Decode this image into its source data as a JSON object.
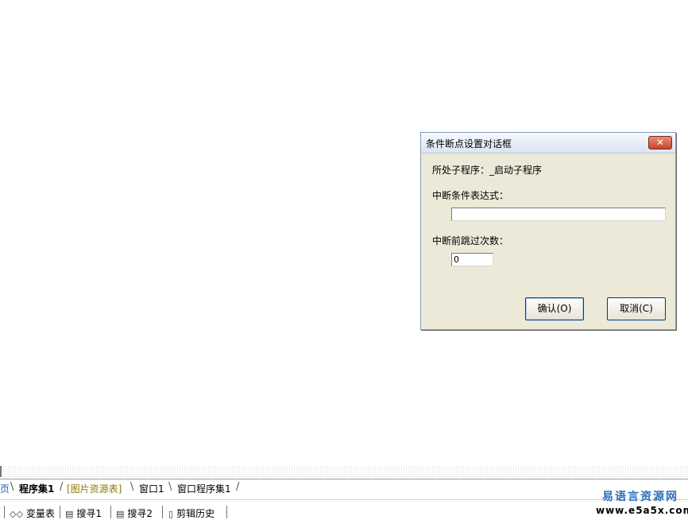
{
  "dialog": {
    "title": "条件断点设置对话框",
    "close_symbol": "✕",
    "subprogram_label": "所处子程序：",
    "subprogram_value": "_启动子程序",
    "condition_label": "中断条件表达式：",
    "condition_value": "",
    "skip_label": "中断前跳过次数：",
    "skip_value": "0",
    "ok_label": "确认(O)",
    "cancel_label": "取消(C)"
  },
  "tabs": [
    {
      "label": "页"
    },
    {
      "label": "程序集1"
    },
    {
      "label": "[图片资源表]"
    },
    {
      "label": "窗口1"
    },
    {
      "label": "窗口程序集1"
    }
  ],
  "toolbar": {
    "items": [
      {
        "label": "变量表",
        "icon": "variables-icon"
      },
      {
        "label": "搜寻1",
        "icon": "search-icon"
      },
      {
        "label": "搜寻2",
        "icon": "search-icon"
      },
      {
        "label": "剪辑历史",
        "icon": "clipboard-history-icon"
      }
    ]
  },
  "watermark": {
    "top": "易语言资源网",
    "bottom": "www.e5a5x.com"
  }
}
